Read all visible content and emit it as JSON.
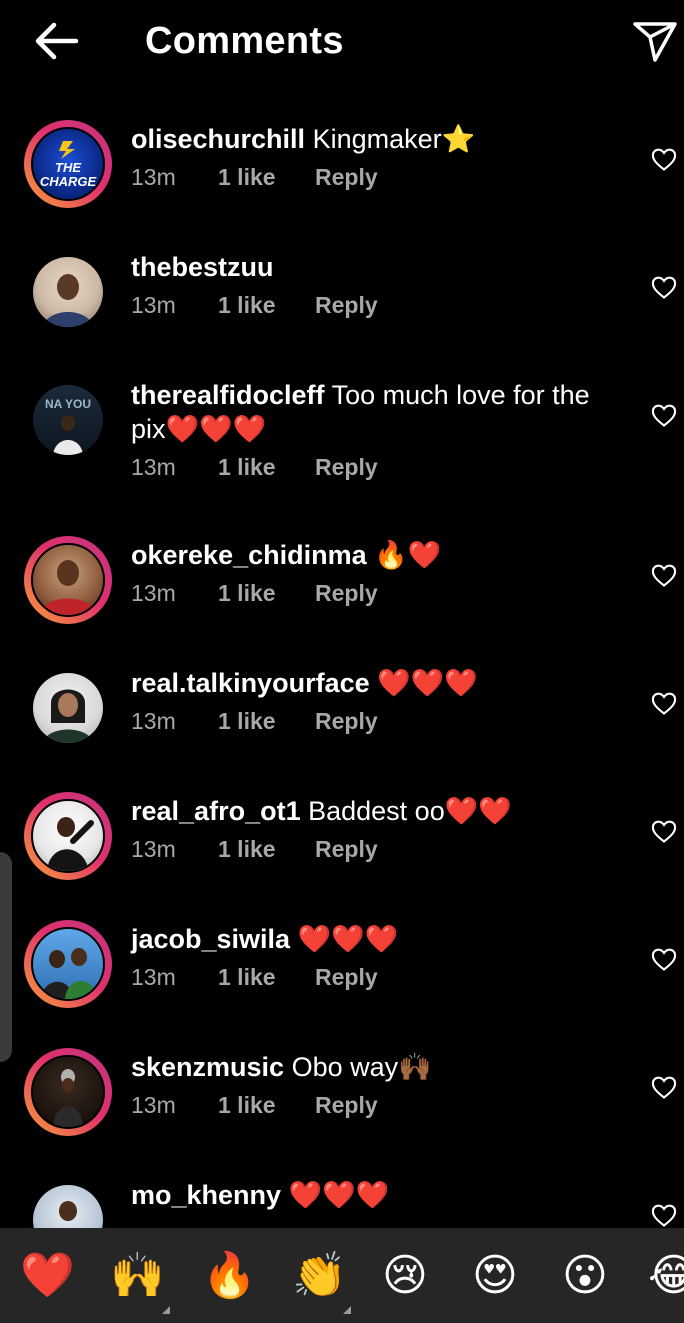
{
  "header": {
    "title": "Comments"
  },
  "comments": [
    {
      "username": "olisechurchill",
      "text": "Kingmaker⭐",
      "time": "13m",
      "likes": "1 like",
      "reply": "Reply",
      "story": true,
      "avatar_text": "THE CHARGE"
    },
    {
      "username": "thebestzuu",
      "text": "",
      "time": "13m",
      "likes": "1 like",
      "reply": "Reply",
      "story": false
    },
    {
      "username": "therealfidocleff",
      "text": "Too much love for the pix❤️❤️❤️",
      "time": "13m",
      "likes": "1 like",
      "reply": "Reply",
      "story": false,
      "avatar_text": "NA YOU"
    },
    {
      "username": "okereke_chidinma",
      "text": "🔥❤️",
      "time": "13m",
      "likes": "1 like",
      "reply": "Reply",
      "story": true
    },
    {
      "username": "real.talkinyourface",
      "text": "❤️❤️❤️",
      "time": "13m",
      "likes": "1 like",
      "reply": "Reply",
      "story": false
    },
    {
      "username": "real_afro_ot1",
      "text": "Baddest oo❤️❤️",
      "time": "13m",
      "likes": "1 like",
      "reply": "Reply",
      "story": true
    },
    {
      "username": "jacob_siwila",
      "text": "❤️❤️❤️",
      "time": "13m",
      "likes": "1 like",
      "reply": "Reply",
      "story": true
    },
    {
      "username": "skenzmusic",
      "text": "Obo way🙌🏾",
      "time": "13m",
      "likes": "1 like",
      "reply": "Reply",
      "story": true
    },
    {
      "username": "mo_khenny",
      "text": "❤️❤️❤️",
      "time": "",
      "likes": "",
      "reply": "",
      "story": false
    }
  ],
  "emoji_bar": [
    "❤️",
    "🙌",
    "🔥",
    "👏",
    "😢",
    "😍",
    "😮",
    "😂"
  ],
  "colors": {
    "background": "#000000",
    "meta": "#a8a8a8",
    "emoji_bar": "#262626",
    "story_ring_start": "#f9a13a",
    "story_ring_end": "#c13584"
  }
}
